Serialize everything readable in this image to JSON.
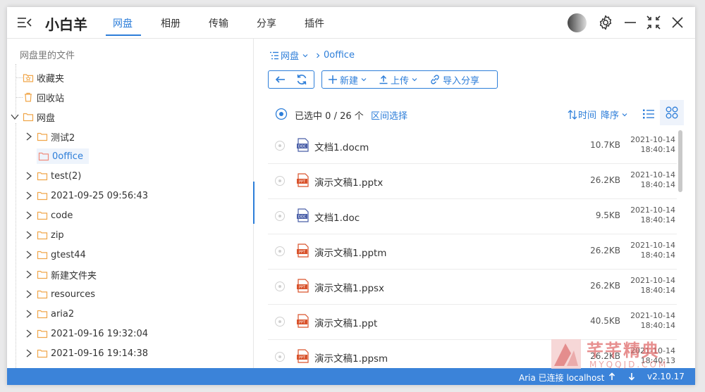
{
  "app": {
    "title": "小白羊"
  },
  "tabs": [
    {
      "label": "网盘",
      "active": true
    },
    {
      "label": "相册",
      "active": false
    },
    {
      "label": "传输",
      "active": false
    },
    {
      "label": "分享",
      "active": false
    },
    {
      "label": "插件",
      "active": false
    }
  ],
  "titlebar_icons": [
    "menu-collapse-icon",
    "avatar",
    "gear-icon",
    "minimize-icon",
    "fullscreen-icon",
    "close-icon"
  ],
  "tree": {
    "root_label": "网盘里的文件",
    "items": [
      {
        "label": "收藏夹",
        "icon": "favorites-folder-icon"
      },
      {
        "label": "回收站",
        "icon": "trash-icon"
      },
      {
        "label": "网盘",
        "icon": "folder-icon",
        "expanded": true
      }
    ],
    "children": [
      {
        "label": "测试2"
      },
      {
        "label": "0office",
        "selected": true
      },
      {
        "label": "test(2)"
      },
      {
        "label": "2021-09-25 09:56:43"
      },
      {
        "label": "code"
      },
      {
        "label": "zip"
      },
      {
        "label": "gtest44"
      },
      {
        "label": "新建文件夹"
      },
      {
        "label": "resources"
      },
      {
        "label": "aria2"
      },
      {
        "label": "2021-09-16 19:32:04"
      },
      {
        "label": "2021-09-16 19:14:38"
      }
    ]
  },
  "breadcrumb": {
    "root": "网盘",
    "current": "0office"
  },
  "toolbar": {
    "new_label": "新建",
    "upload_label": "上传",
    "import_label": "导入分享"
  },
  "selection": {
    "prefix": "已选中",
    "selected": "0",
    "separator": "/",
    "total": "26",
    "unit": "个",
    "range_label": "区间选择"
  },
  "sort": {
    "field": "时间",
    "order": "降序"
  },
  "files": [
    {
      "name": "文档1.docm",
      "type": "doc",
      "size": "10.7KB",
      "date": "2021-10-14",
      "time": "18:40:14"
    },
    {
      "name": "演示文稿1.pptx",
      "type": "ppt",
      "size": "26.2KB",
      "date": "2021-10-14",
      "time": "18:40:14"
    },
    {
      "name": "文档1.doc",
      "type": "doc",
      "size": "9.5KB",
      "date": "2021-10-14",
      "time": "18:40:14"
    },
    {
      "name": "演示文稿1.pptm",
      "type": "ppt",
      "size": "26.2KB",
      "date": "2021-10-14",
      "time": "18:40:14"
    },
    {
      "name": "演示文稿1.ppsx",
      "type": "ppt",
      "size": "26.2KB",
      "date": "2021-10-14",
      "time": "18:40:14"
    },
    {
      "name": "演示文稿1.ppt",
      "type": "ppt",
      "size": "40.5KB",
      "date": "2021-10-14",
      "time": "18:40:14"
    },
    {
      "name": "演示文稿1.ppsm",
      "type": "ppt",
      "size": "26.2KB",
      "date": "2021-10-14",
      "time": "18:40:13"
    }
  ],
  "status": {
    "aria": "Aria 已连接 localhost",
    "version": "v2.10.17"
  },
  "watermark": {
    "title": "芊芊精典",
    "subtitle": "MYQQJD.COM"
  },
  "colors": {
    "accent": "#2d7ed9",
    "status_bar": "#3b83d9",
    "folder": "#f0a64a",
    "ppt": "#d9532c",
    "doc": "#4a5fa8"
  }
}
